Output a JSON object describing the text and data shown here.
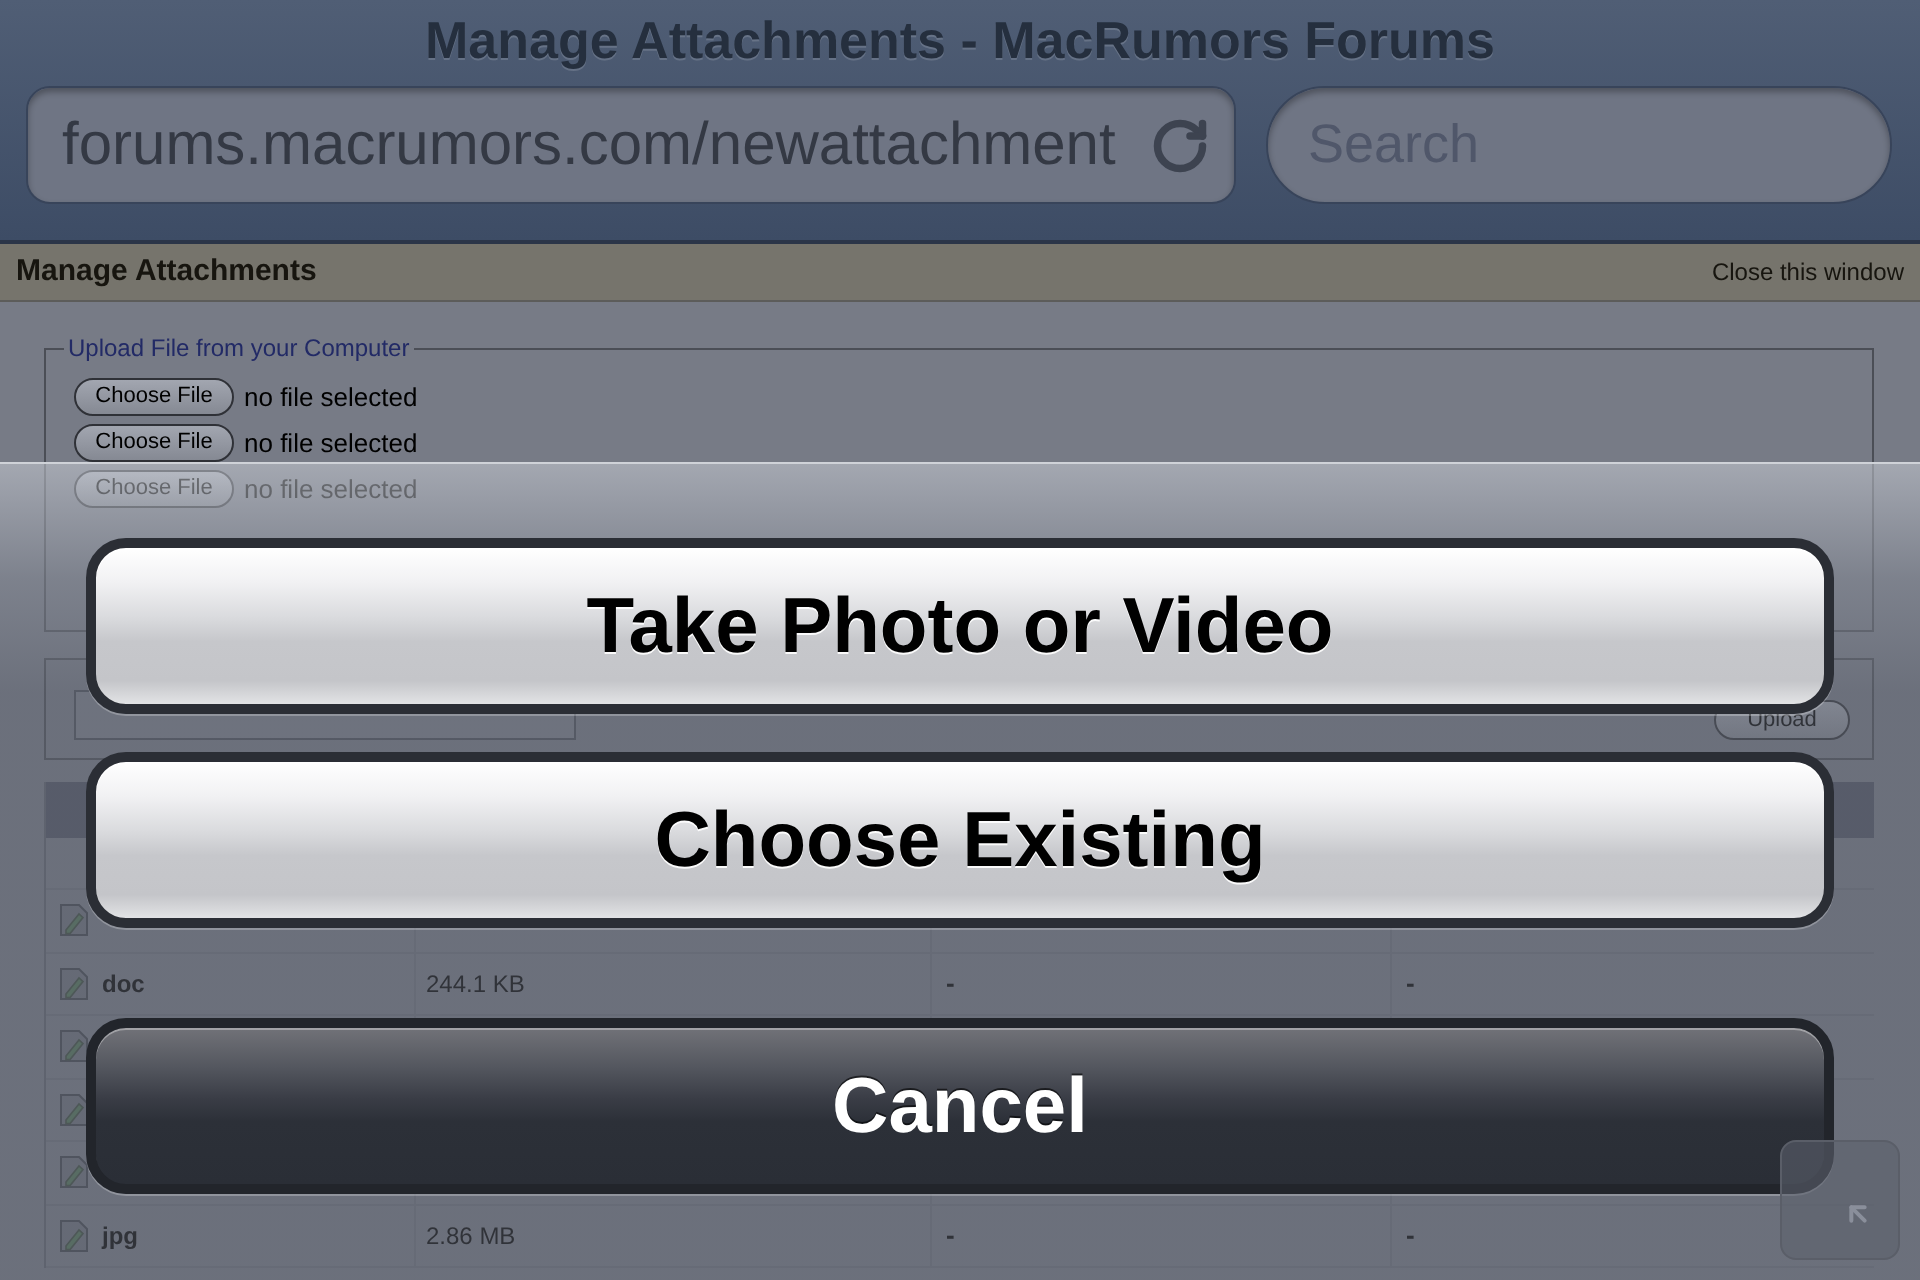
{
  "browser": {
    "title": "Manage Attachments - MacRumors Forums",
    "url": "forums.macrumors.com/newattachment",
    "search": {
      "placeholder": "Search"
    }
  },
  "page": {
    "header": {
      "title": "Manage Attachments",
      "close_link": "Close this window"
    },
    "upload_from_computer": {
      "legend": "Upload File from your Computer",
      "rows": [
        {
          "kind": "shown",
          "button": "Choose File",
          "status": "no file selected"
        },
        {
          "kind": "shown",
          "button": "Choose File",
          "status": "no file selected"
        },
        {
          "kind": "shown",
          "button": "Choose File",
          "status": "no file selected"
        },
        {
          "kind": "covered"
        }
      ]
    },
    "upload_from_url": {
      "button": "Upload"
    },
    "attachments": {
      "rows": [
        {
          "kind": "covered"
        },
        {
          "kind": "shown",
          "name": "doc",
          "size": "244.1 KB",
          "column_3": "-",
          "column_4": "-"
        },
        {
          "kind": "covered"
        },
        {
          "kind": "covered"
        },
        {
          "kind": "covered"
        },
        {
          "kind": "shown",
          "name": "jpg",
          "size": "2.86 MB",
          "column_3": "-",
          "column_4": "-"
        }
      ]
    }
  },
  "action_sheet": {
    "buttons": [
      {
        "kind": "default",
        "label": "Take Photo or Video"
      },
      {
        "kind": "default",
        "label": "Choose Existing"
      },
      {
        "kind": "cancel",
        "label": "Cancel"
      }
    ]
  }
}
